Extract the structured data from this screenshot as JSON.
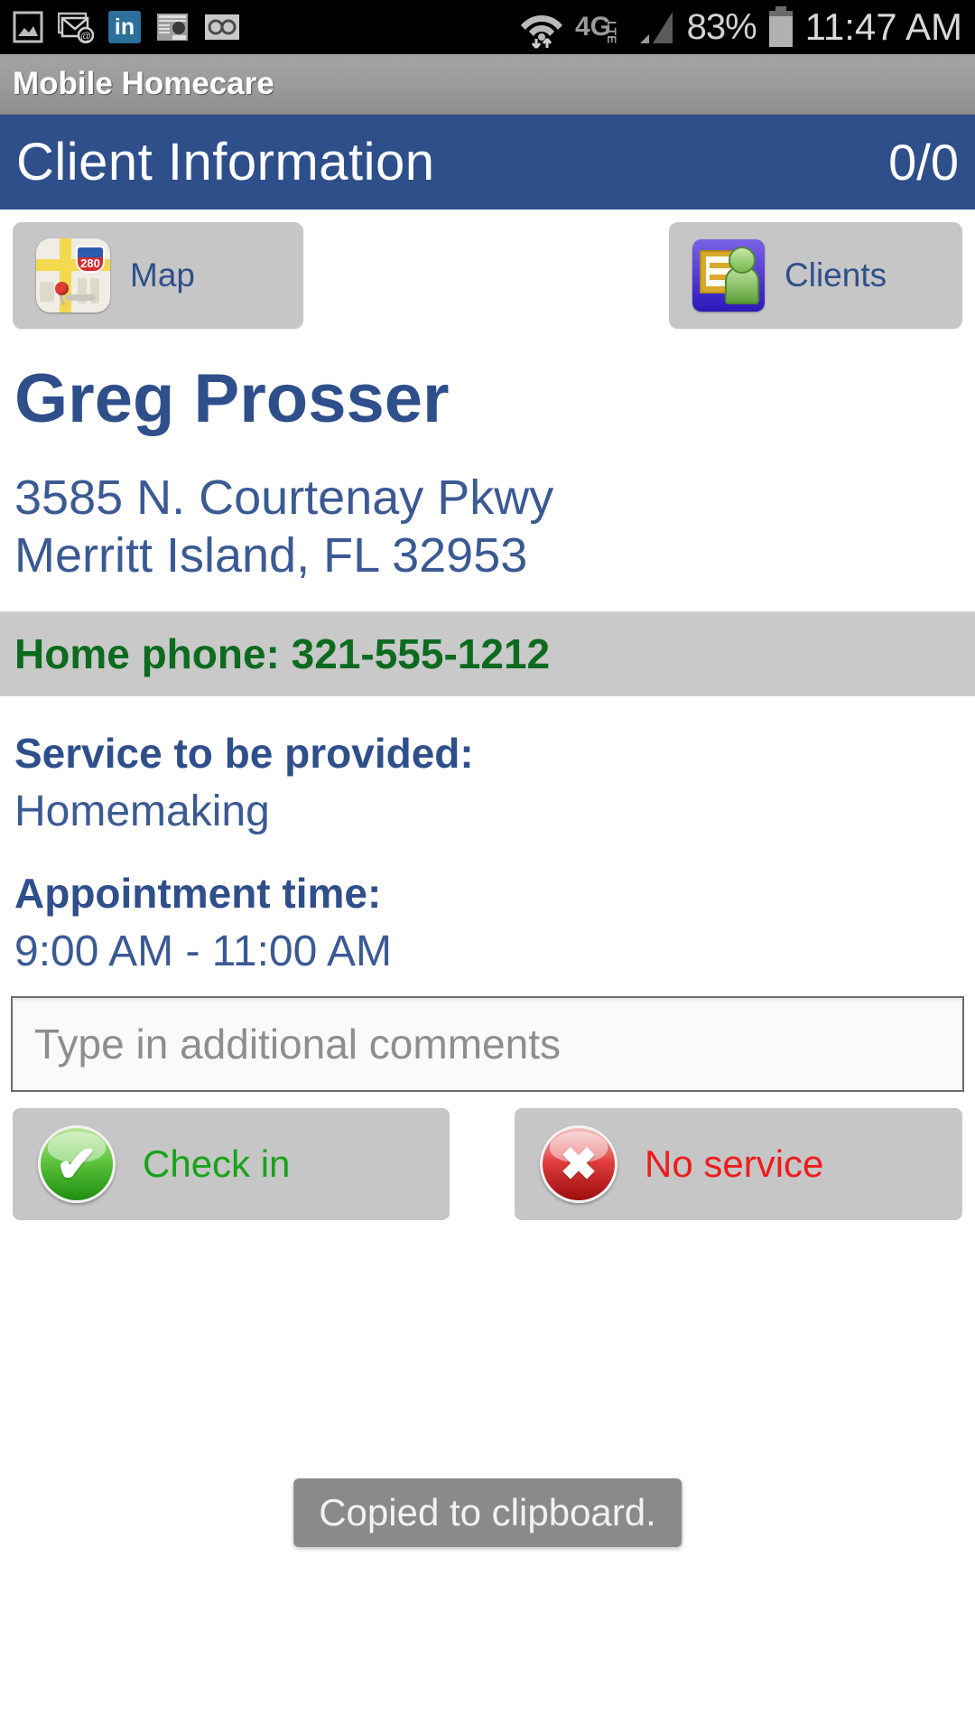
{
  "statusbar": {
    "icons_left": [
      "screenshot-icon",
      "email-icon",
      "linkedin-icon",
      "news-icon",
      "voicemail-icon"
    ],
    "linkedin_label": "in",
    "wifi": "wifi-icon",
    "network": "4G LTE",
    "signal": "signal-bars-icon",
    "battery_percent": "83%",
    "battery": "battery-icon",
    "time": "11:47 AM"
  },
  "appbar": {
    "title": "Mobile Homecare"
  },
  "header": {
    "title": "Client Information",
    "count": "0/0"
  },
  "nav": {
    "map": {
      "label": "Map",
      "icon": "map-icon",
      "shield_number": "280"
    },
    "clients": {
      "label": "Clients",
      "icon": "clients-icon"
    }
  },
  "client": {
    "name": "Greg Prosser",
    "address_line1": "3585 N. Courtenay Pkwy",
    "address_line2": "Merritt Island, FL 32953",
    "phone_text": "Home phone: 321-555-1212"
  },
  "details": {
    "service_label": "Service to be provided:",
    "service_value": "Homemaking",
    "appointment_label": "Appointment time:",
    "appointment_value": "9:00 AM - 11:00 AM"
  },
  "comments": {
    "value": "",
    "placeholder": "Type in additional comments"
  },
  "actions": {
    "check_in": {
      "label": "Check in",
      "icon": "check-circle-icon",
      "glyph": "✔"
    },
    "no_service": {
      "label": "No service",
      "icon": "x-circle-icon",
      "glyph": "✖"
    }
  },
  "toast": {
    "message": "Copied to clipboard."
  },
  "colors": {
    "header_blue": "#2f4f8b",
    "text_blue": "#3b5a94",
    "phone_green": "#0c6b1e",
    "button_gray": "#c6c6c6",
    "check_green": "#17a317",
    "no_service_red": "#ee1c1c",
    "toast_gray": "#8a8a8a"
  }
}
